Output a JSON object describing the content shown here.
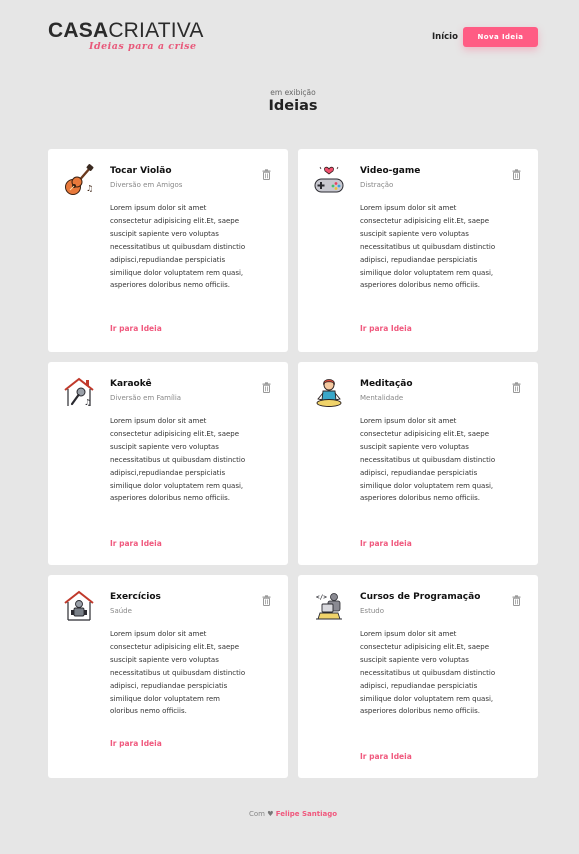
{
  "header": {
    "logo_part1": "CASA",
    "logo_part2": "CRIATIVA",
    "logo_tagline": "Ideias para a crise",
    "nav_home": "Início",
    "nav_button": "Nova Ideia"
  },
  "main": {
    "subtitle": "em exibição",
    "title": "Ideias"
  },
  "colors": {
    "accent": "#ff5c84",
    "background": "#e6e6e6"
  },
  "cards": [
    {
      "icon": "guitar-icon",
      "title": "Tocar Violão",
      "category": "Diversão em Amigos",
      "description": "Lorem ipsum dolor sit amet consectetur adipisicing elit.Et, saepe suscipit sapiente vero voluptas necessitatibus ut quibusdam distinctio adipisci,repudiandae perspiciatis similique dolor voluptatem rem quasi, asperiores doloribus nemo officiis.",
      "link": "Ir para Ideia"
    },
    {
      "icon": "gamepad-icon",
      "title": "Video-game",
      "category": "Distração",
      "description": "Lorem ipsum dolor sit amet consectetur adipisicing elit.Et, saepe suscipit sapiente vero voluptas necessitatibus ut quibusdam distinctio adipisci, repudiandae perspiciatis similique dolor voluptatem rem quasi, asperiores doloribus nemo officiis.",
      "link": "Ir para Ideia"
    },
    {
      "icon": "karaoke-icon",
      "title": "Karaokê",
      "category": "Diversão em Família",
      "description": "Lorem ipsum dolor sit amet consectetur adipisicing elit.Et, saepe suscipit sapiente vero voluptas necessitatibus ut quibusdam distinctio adipisci,repudiandae perspiciatis similique dolor voluptatem rem quasi, asperiores doloribus nemo officiis.",
      "link": "Ir para Ideia"
    },
    {
      "icon": "meditation-icon",
      "title": "Meditação",
      "category": "Mentalidade",
      "description": "Lorem ipsum dolor sit amet consectetur adipisicing elit.Et, saepe suscipit sapiente vero voluptas necessitatibus ut quibusdam distinctio adipisci, repudiandae perspiciatis similique dolor voluptatem rem quasi, asperiores doloribus nemo officiis.",
      "link": "Ir para Ideia"
    },
    {
      "icon": "exercise-icon",
      "title": "Exercícios",
      "category": "Saúde",
      "description": "Lorem ipsum dolor sit amet consectetur adipisicing elit.Et, saepe suscipit sapiente vero voluptas necessitatibus ut quibusdam distinctio adipisci, repudiandae perspiciatis similique dolor voluptatem rem oloribus nemo officiis.",
      "link": "Ir para Ideia"
    },
    {
      "icon": "programming-icon",
      "title": "Cursos de Programação",
      "category": "Estudo",
      "description": "Lorem ipsum dolor sit amet consectetur adipisicing elit.Et, saepe suscipit sapiente vero voluptas necessitatibus ut quibusdam distinctio adipisci, repudiandae perspiciatis similique dolor voluptatem rem quasi, asperiores doloribus nemo officiis.",
      "link": "Ir para Ideia"
    }
  ],
  "footer": {
    "prefix": "Com",
    "heart": "♥",
    "author": "Felipe Santiago"
  }
}
